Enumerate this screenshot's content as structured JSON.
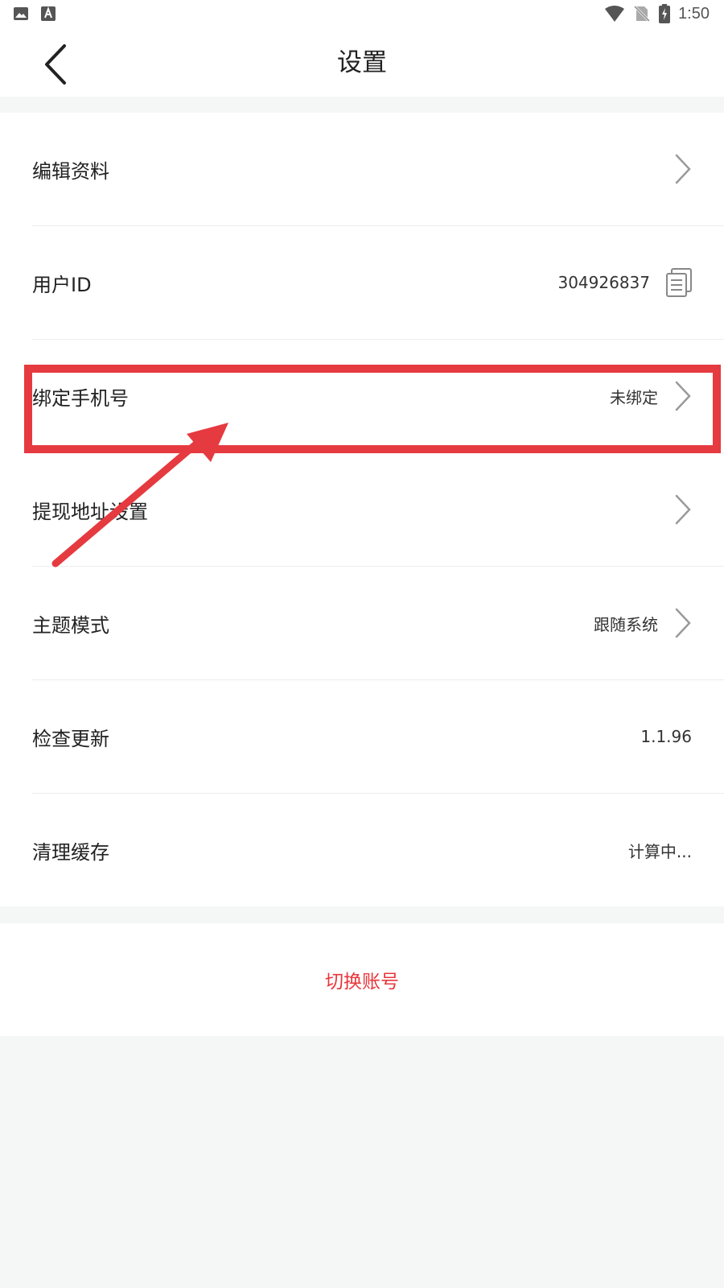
{
  "status_bar": {
    "time": "1:50",
    "left_icons": [
      "gallery-icon",
      "font-a-icon"
    ],
    "right_icons": [
      "wifi-icon",
      "no-sim-icon",
      "battery-charging-icon"
    ]
  },
  "header": {
    "title": "设置",
    "back_icon": "chevron-left-icon"
  },
  "settings": {
    "items": [
      {
        "label": "编辑资料",
        "value": "",
        "trailing": "chevron-right-icon"
      },
      {
        "label": "用户ID",
        "value": "304926837",
        "trailing": "copy-icon"
      },
      {
        "label": "绑定手机号",
        "value": "未绑定",
        "trailing": "chevron-right-icon"
      },
      {
        "label": "提现地址设置",
        "value": "",
        "trailing": "chevron-right-icon"
      },
      {
        "label": "主题模式",
        "value": "跟随系统",
        "trailing": "chevron-right-icon"
      },
      {
        "label": "检查更新",
        "value": "1.1.96",
        "trailing": ""
      },
      {
        "label": "清理缓存",
        "value": "计算中...",
        "trailing": ""
      }
    ]
  },
  "account": {
    "switch_label": "切换账号"
  },
  "colors": {
    "accent": "#e8363c",
    "annotation": "#e53a3f",
    "background": "#f5f6f6",
    "card": "#ffffff"
  }
}
